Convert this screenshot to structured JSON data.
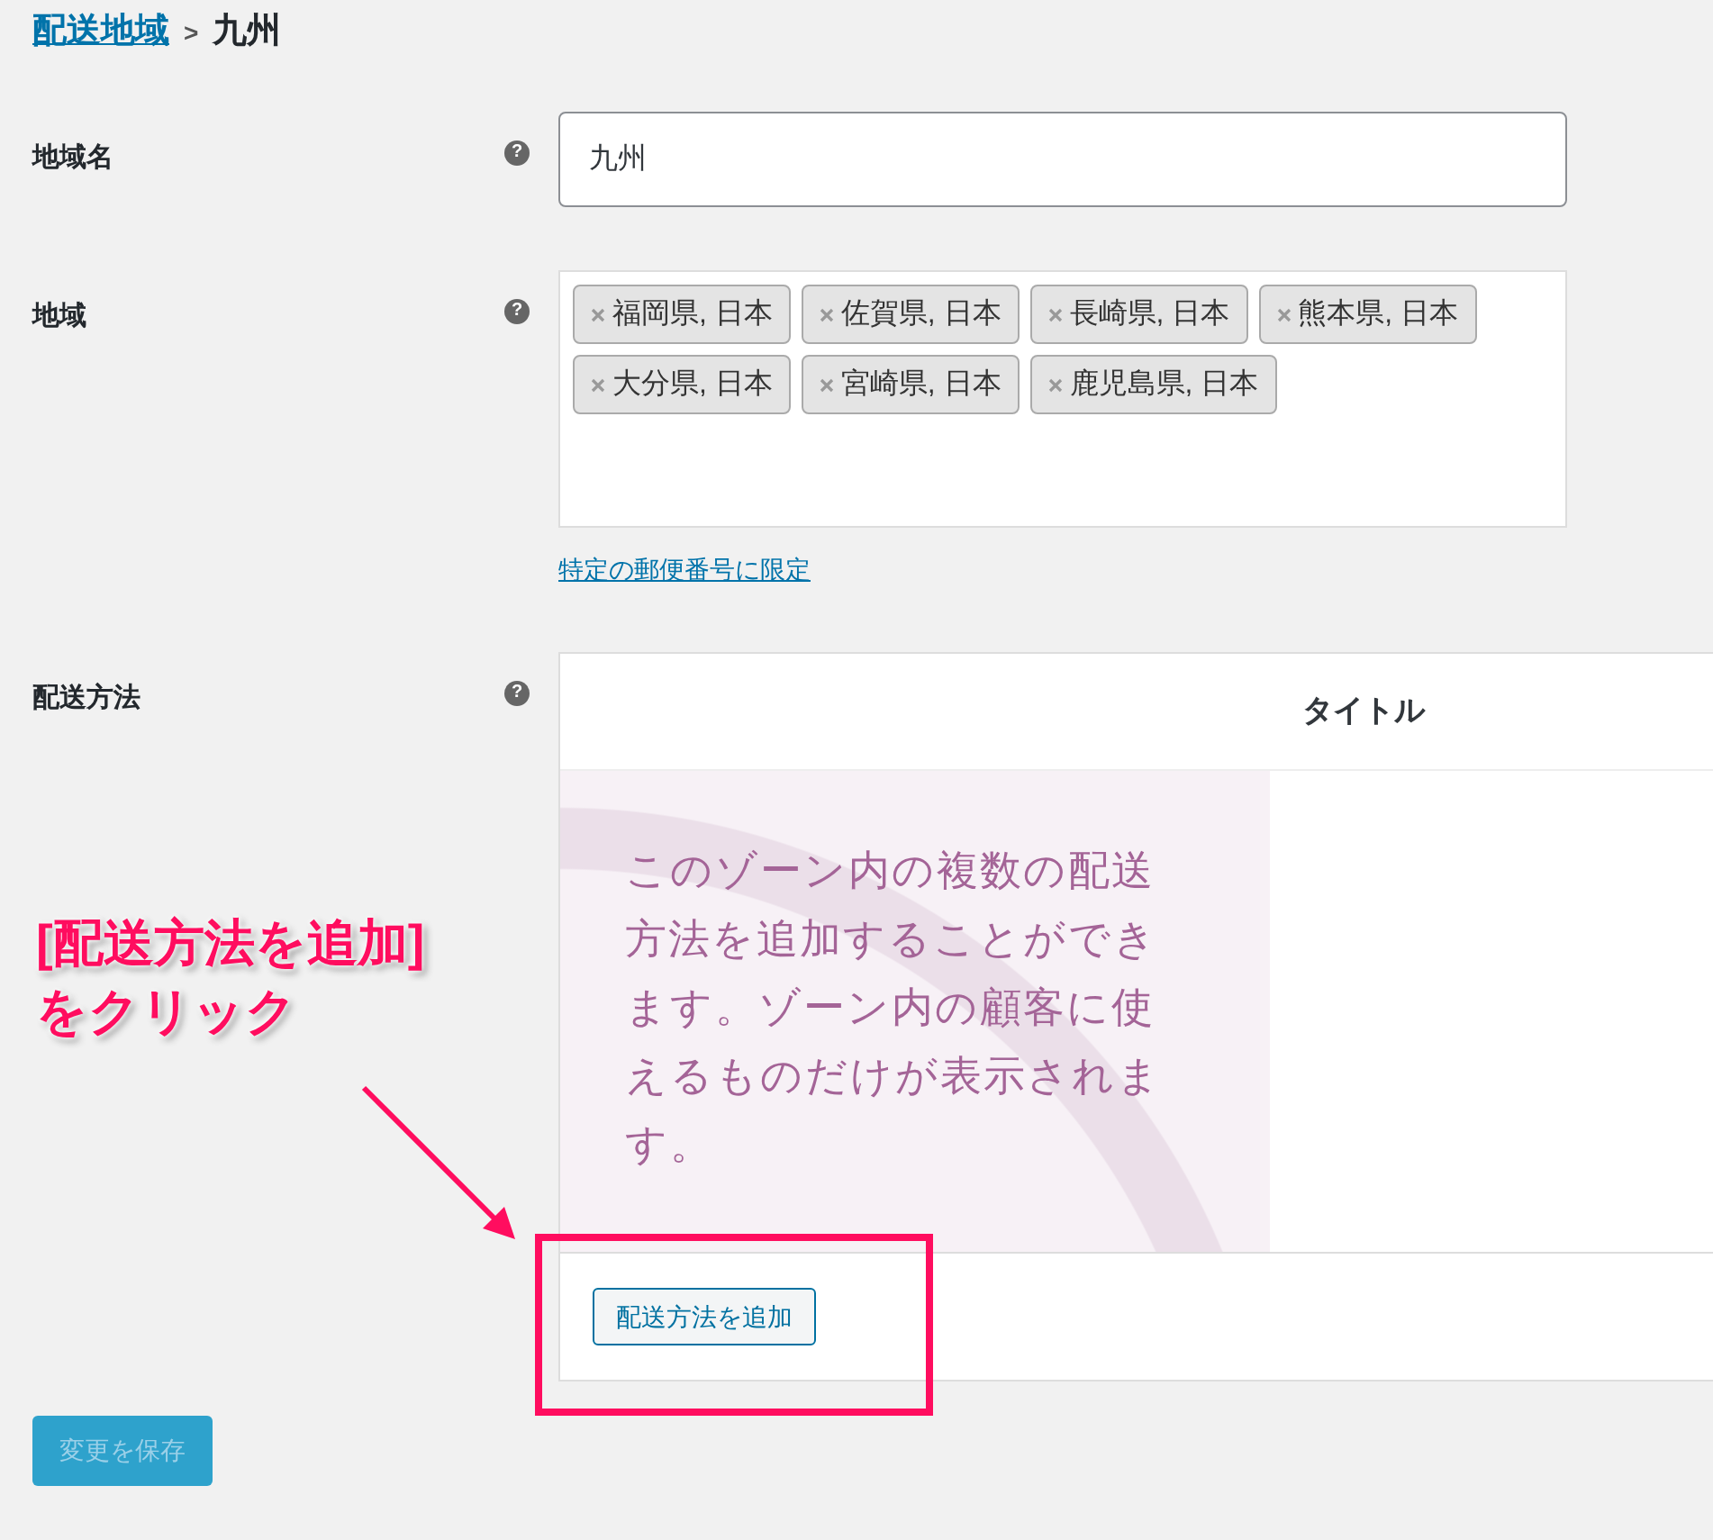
{
  "breadcrumb": {
    "link": "配送地域",
    "separator": ">",
    "current": "九州"
  },
  "fields": [
    {
      "kind": "input",
      "label": "地域名",
      "help": "?",
      "value": "九州"
    },
    {
      "kind": "tags",
      "label": "地域",
      "help": "?",
      "tags": [
        "福岡県, 日本",
        "佐賀県, 日本",
        "長崎県, 日本",
        "熊本県, 日本",
        "大分県, 日本",
        "宮崎県, 日本",
        "鹿児島県, 日本"
      ],
      "link": "特定の郵便番号に限定"
    },
    {
      "kind": "methods",
      "label": "配送方法",
      "help": "?",
      "column": "タイトル",
      "blank_text": "このゾーン内の複数の配送方法を追加することができます。ゾーン内の顧客に使えるものだけが表示されます。",
      "add_button": "配送方法を追加"
    }
  ],
  "save_button": {
    "label": "変更を保存",
    "disabled": true
  },
  "annotation": {
    "line_1": "[配送方法を追加]",
    "line_2": "をクリック"
  }
}
